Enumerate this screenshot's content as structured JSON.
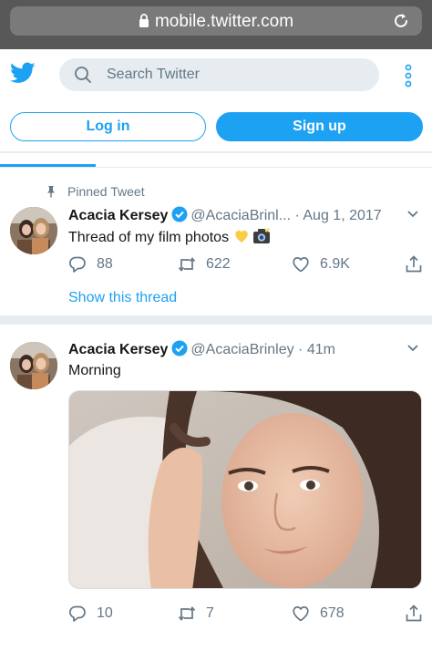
{
  "browser": {
    "url": "mobile.twitter.com"
  },
  "header": {
    "search_placeholder": "Search Twitter"
  },
  "auth": {
    "login_label": "Log in",
    "signup_label": "Sign up"
  },
  "tweets": [
    {
      "pinned_label": "Pinned Tweet",
      "name": "Acacia Kersey",
      "handle": "@AcaciaBrinl...",
      "separator": "·",
      "time": "Aug 1, 2017",
      "text": "Thread of my film photos",
      "replies": "88",
      "retweets": "622",
      "likes": "6.9K",
      "show_thread": "Show this thread"
    },
    {
      "name": "Acacia Kersey",
      "handle": "@AcaciaBrinley",
      "separator": "·",
      "time": "41m",
      "text": "Morning",
      "replies": "10",
      "retweets": "7",
      "likes": "678"
    }
  ],
  "colors": {
    "twitter_blue": "#1da1f2",
    "secondary_text": "#657786",
    "separator": "#e6ecf0"
  },
  "icons": [
    "lock-icon",
    "reload-icon",
    "twitter-bird-icon",
    "search-icon",
    "more-vertical-icon",
    "pin-icon",
    "verified-icon",
    "chevron-down-icon",
    "reply-icon",
    "retweet-icon",
    "like-icon",
    "share-icon"
  ]
}
